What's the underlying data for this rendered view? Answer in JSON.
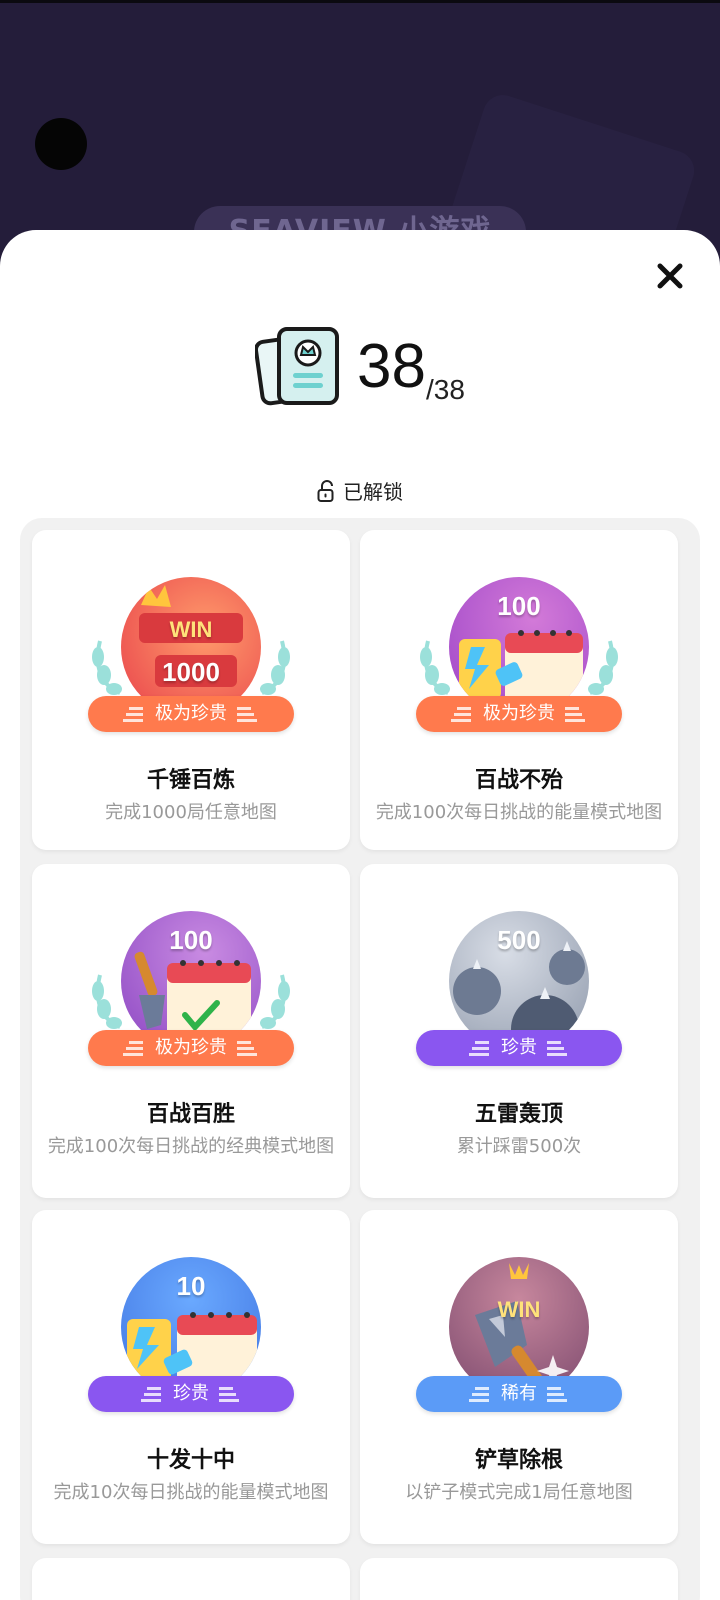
{
  "background": {
    "title": "SEAVIEW 小游戏"
  },
  "summary": {
    "count": "38",
    "total": "/38",
    "icon": "achievement-cards-icon"
  },
  "section": {
    "label": "已解锁",
    "icon": "unlock-icon"
  },
  "close": {
    "icon": "close-icon"
  },
  "colors": {
    "orange_rarity": "#ff7a4d",
    "purple_rarity": "#8a56f0",
    "blue_rarity": "#5b9bf7"
  },
  "cards": [
    {
      "medal_text": "WIN 1000",
      "rarity": "极为珍贵",
      "title": "千锤百炼",
      "desc": "完成1000局任意地图"
    },
    {
      "medal_text": "100",
      "rarity": "极为珍贵",
      "title": "百战不殆",
      "desc": "完成100次每日挑战的能量模式地图"
    },
    {
      "medal_text": "100",
      "rarity": "极为珍贵",
      "title": "百战百胜",
      "desc": "完成100次每日挑战的经典模式地图"
    },
    {
      "medal_text": "500",
      "rarity": "珍贵",
      "title": "五雷轰顶",
      "desc": "累计踩雷500次"
    },
    {
      "medal_text": "10",
      "rarity": "珍贵",
      "title": "十发十中",
      "desc": "完成10次每日挑战的能量模式地图"
    },
    {
      "medal_text": "WIN",
      "rarity": "稀有",
      "title": "铲草除根",
      "desc": "以铲子模式完成1局任意地图"
    }
  ]
}
